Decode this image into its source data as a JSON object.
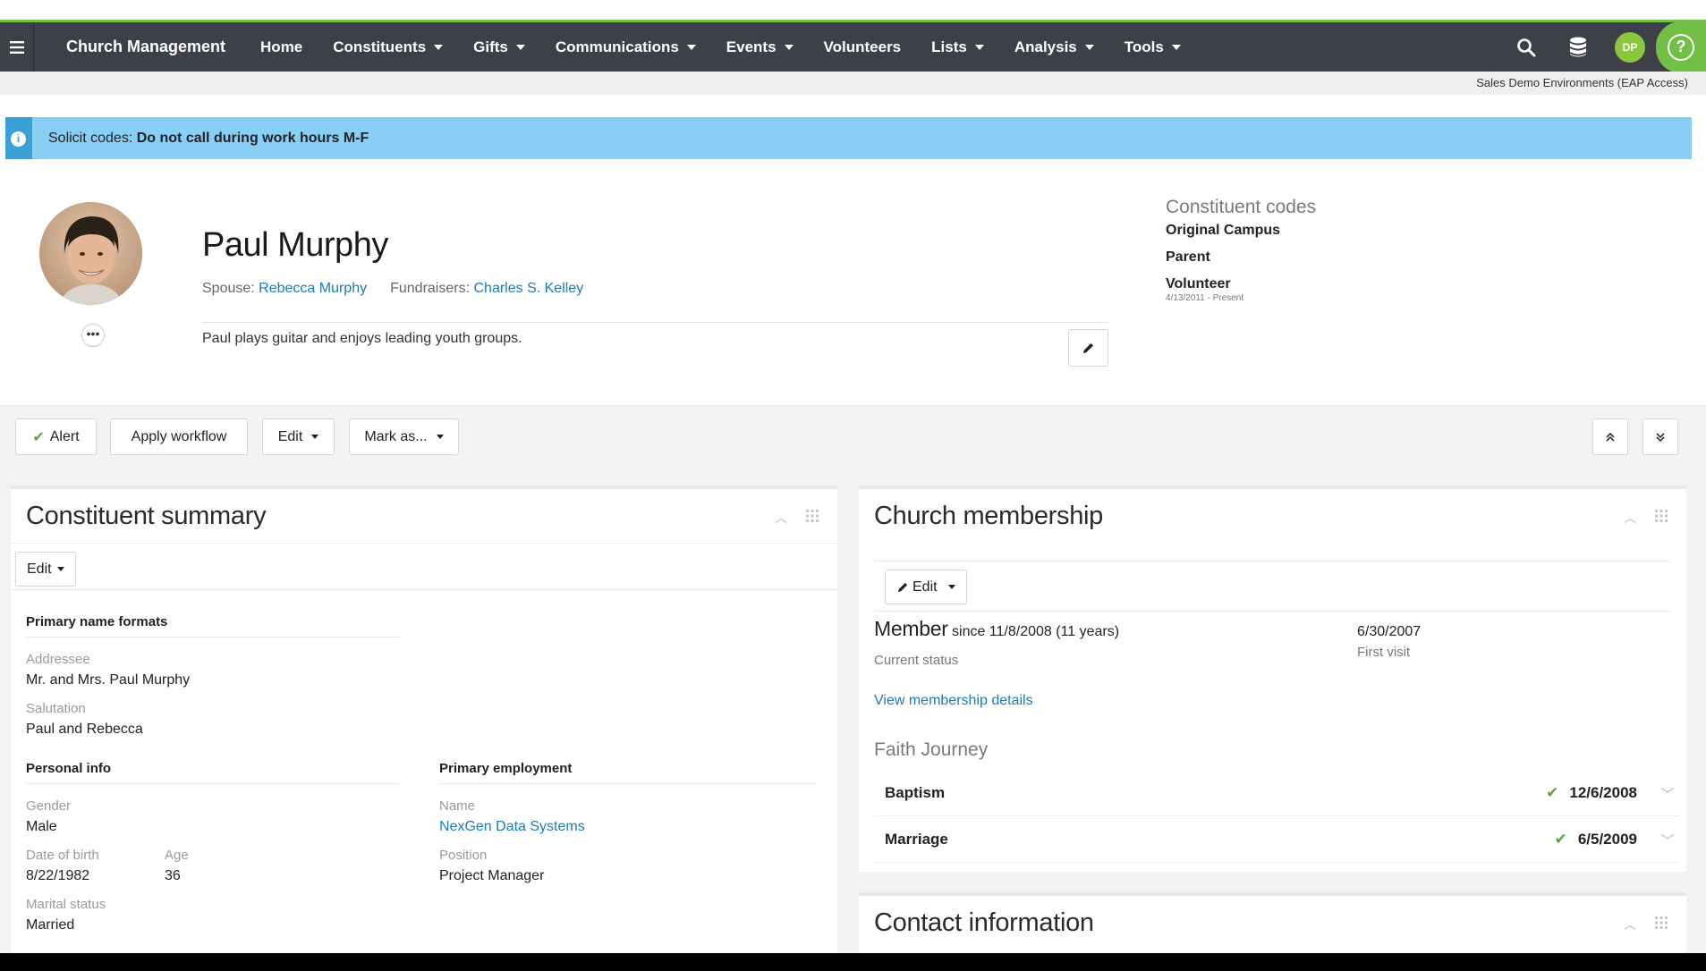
{
  "nav": {
    "brand": "Church Management",
    "items": [
      {
        "label": "Home",
        "has_menu": false
      },
      {
        "label": "Constituents",
        "has_menu": true
      },
      {
        "label": "Gifts",
        "has_menu": true
      },
      {
        "label": "Communications",
        "has_menu": true
      },
      {
        "label": "Events",
        "has_menu": true
      },
      {
        "label": "Volunteers",
        "has_menu": false
      },
      {
        "label": "Lists",
        "has_menu": true
      },
      {
        "label": "Analysis",
        "has_menu": true
      },
      {
        "label": "Tools",
        "has_menu": true
      }
    ],
    "user_initials": "DP",
    "help_label": "?",
    "environment": "Sales Demo Environments (EAP Access)"
  },
  "alert": {
    "prefix": "Solicit codes: ",
    "message": "Do not call during work hours M-F"
  },
  "profile": {
    "name": "Paul Murphy",
    "spouse_label": "Spouse: ",
    "spouse": "Rebecca Murphy",
    "fundraisers_label": "Fundraisers: ",
    "fundraisers": "Charles S. Kelley",
    "bio": "Paul plays guitar and enjoys leading youth groups.",
    "more_label": "•••",
    "codes_title": "Constituent codes",
    "codes": [
      "Original Campus",
      "Parent",
      "Volunteer"
    ],
    "volunteer_date": "4/13/2011 - Present"
  },
  "actions": {
    "alert": "Alert",
    "apply_workflow": "Apply workflow",
    "edit": "Edit",
    "mark_as": "Mark as..."
  },
  "summary": {
    "title": "Constituent summary",
    "edit": "Edit",
    "primary_name_formats": "Primary name formats",
    "addressee_label": "Addressee",
    "addressee": "Mr. and Mrs. Paul Murphy",
    "salutation_label": "Salutation",
    "salutation": "Paul and Rebecca",
    "personal_info": "Personal info",
    "gender_label": "Gender",
    "gender": "Male",
    "dob_label": "Date of birth",
    "dob": "8/22/1982",
    "age_label": "Age",
    "age": "36",
    "marital_label": "Marital status",
    "marital": "Married",
    "employment": "Primary employment",
    "emp_name_label": "Name",
    "emp_name": "NexGen Data Systems",
    "position_label": "Position",
    "position": "Project Manager"
  },
  "membership": {
    "title": "Church membership",
    "edit": "Edit",
    "status": "Member",
    "since": " since 11/8/2008 (11 years)",
    "status_label": "Current status",
    "first_visit": "6/30/2007",
    "first_visit_label": "First visit",
    "view_details": "View membership details",
    "faith_journey": "Faith Journey",
    "journey": [
      {
        "label": "Baptism",
        "date": "12/6/2008"
      },
      {
        "label": "Marriage",
        "date": "6/5/2009"
      }
    ]
  },
  "contact": {
    "title": "Contact information"
  },
  "colors": {
    "navbar": "#3d4147",
    "accent_green": "#71bf44",
    "banner": "#89cff5",
    "link": "#1b7bb8"
  }
}
